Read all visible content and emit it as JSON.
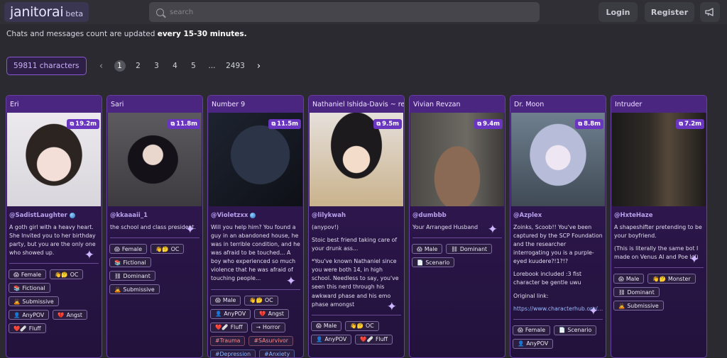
{
  "header": {
    "logo_text": "janitorai",
    "logo_badge": "beta",
    "search_placeholder": "search",
    "login_label": "Login",
    "register_label": "Register",
    "announce_icon": "megaphone-icon"
  },
  "notice": {
    "text": "Chats and messages count are updated ",
    "emphasis": "every 15-30 minutes."
  },
  "pagination": {
    "characters_count": "59811 characters",
    "prev_icon": "‹",
    "current": "1",
    "pages": [
      "2",
      "3",
      "4",
      "5",
      "...",
      "2493"
    ],
    "next_icon": "›"
  },
  "colors": {
    "accent": "#8b58d6",
    "card_header": "#4a2680",
    "count_badge": "#6a36c0"
  },
  "cards": [
    {
      "name": "Eri",
      "count": "19.2m",
      "creator": "@SadistLaughter",
      "verified": true,
      "desc": [
        "A goth girl with a heavy heart. She Invited you to her birthday party, but you are the only one who showed up."
      ],
      "tags": [
        [
          "😱",
          "Female"
        ],
        [
          "👋🤔",
          "OC"
        ],
        [
          "📚",
          "Fictional"
        ],
        [
          "🙇",
          "Submissive"
        ],
        [
          "👤",
          "AnyPOV"
        ],
        [
          "💔",
          "Angst"
        ],
        [
          "❤️🩹",
          "Fluff"
        ]
      ]
    },
    {
      "name": "Sari",
      "count": "11.8m",
      "creator": "@kkaaaii_1",
      "verified": false,
      "desc": [
        "the school and class president."
      ],
      "tags": [
        [
          "😱",
          "Female"
        ],
        [
          "👋🤔",
          "OC"
        ],
        [
          "📚",
          "Fictional"
        ],
        [
          "⛓",
          "Dominant"
        ],
        [
          "🙇",
          "Submissive"
        ]
      ]
    },
    {
      "name": "Number 9",
      "count": "11.5m",
      "creator": "@Violetzxx",
      "verified": true,
      "desc": [
        "Will you help him? You found a guy in an abandoned house, he was in terrible condition, and he was afraid to be touched... A boy who experienced so much violence that he was afraid of touching people..."
      ],
      "tags": [
        [
          "😱",
          "Male"
        ],
        [
          "👋🤔",
          "OC"
        ],
        [
          "👤",
          "AnyPOV"
        ],
        [
          "💔",
          "Angst"
        ],
        [
          "❤️🩹",
          "Fluff"
        ],
        [
          "→",
          "Horror"
        ],
        [
          "",
          "#Trauma"
        ],
        [
          "",
          "#SAsurvivor"
        ],
        [
          "",
          "#Depression"
        ],
        [
          "",
          "#Anxiety"
        ]
      ]
    },
    {
      "name": "Nathaniel Ishida-Davis ~ re...",
      "count": "9.5m",
      "creator": "@lilykwah",
      "verified": false,
      "desc": [
        "(anypov!)",
        "Stoic best friend taking care of your drunk ass...",
        "*You've known Nathaniel since you were both 14, in high school. Needless to say, you've seen this nerd through his awkward phase and his emo phase amongst"
      ],
      "tags": [
        [
          "😱",
          "Male"
        ],
        [
          "👋🤔",
          "OC"
        ],
        [
          "👤",
          "AnyPOV"
        ],
        [
          "❤️🩹",
          "Fluff"
        ]
      ]
    },
    {
      "name": "Vivian Revzan",
      "count": "9.4m",
      "creator": "@dumbbb",
      "verified": false,
      "desc": [
        "Your Arranged Husband"
      ],
      "tags": [
        [
          "😱",
          "Male"
        ],
        [
          "⛓",
          "Dominant"
        ],
        [
          "📄",
          "Scenario"
        ]
      ]
    },
    {
      "name": "Dr. Moon",
      "count": "8.8m",
      "creator": "@Azplex",
      "verified": false,
      "desc": [
        "Zoinks, Scoob!! You've been captured by the SCP Foundation and the researcher interrogating you is a purple-eyed kuudere?!1?!?",
        "Lorebook included :3 fist character be gentle uwu",
        "Original link:"
      ],
      "link": "https://www.characterhub.org/...",
      "tags": [
        [
          "😱",
          "Female"
        ],
        [
          "📄",
          "Scenario"
        ],
        [
          "👤",
          "AnyPOV"
        ]
      ]
    },
    {
      "name": "Intruder",
      "count": "7.2m",
      "creator": "@HxteHaze",
      "verified": false,
      "desc": [
        "A shapeshifter pretending to be your boyfriend.",
        "(This is literally the same bot I made on Venus AI and Poe lol)"
      ],
      "tags": [
        [
          "😱",
          "Male"
        ],
        [
          "👋🤔",
          "Monster"
        ],
        [
          "⛓",
          "Dominant"
        ],
        [
          "🙇",
          "Submissive"
        ]
      ]
    }
  ]
}
